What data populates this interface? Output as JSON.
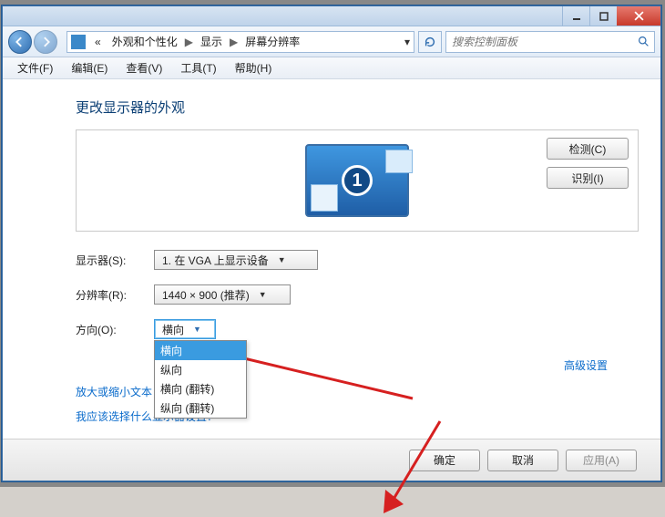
{
  "breadcrumb": {
    "root": "«",
    "part1": "外观和个性化",
    "part2": "显示",
    "part3": "屏幕分辨率"
  },
  "search": {
    "placeholder": "搜索控制面板"
  },
  "menu": {
    "file": "文件(F)",
    "edit": "编辑(E)",
    "view": "查看(V)",
    "tools": "工具(T)",
    "help": "帮助(H)"
  },
  "heading": "更改显示器的外观",
  "buttons": {
    "detect": "检测(C)",
    "identify": "识别(I)"
  },
  "display": {
    "label": "显示器(S):",
    "value": "1. 在 VGA 上显示设备"
  },
  "resolution": {
    "label": "分辨率(R):",
    "value": "1440 × 900 (推荐)"
  },
  "orientation": {
    "label": "方向(O):",
    "value": "横向",
    "options": [
      "横向",
      "纵向",
      "横向 (翻转)",
      "纵向 (翻转)"
    ]
  },
  "links": {
    "advanced": "高级设置",
    "textsize": "放大或缩小文本",
    "which": "我应该选择什么显示器设置？"
  },
  "footer": {
    "ok": "确定",
    "cancel": "取消",
    "apply": "应用(A)"
  },
  "monitor_number": "1"
}
